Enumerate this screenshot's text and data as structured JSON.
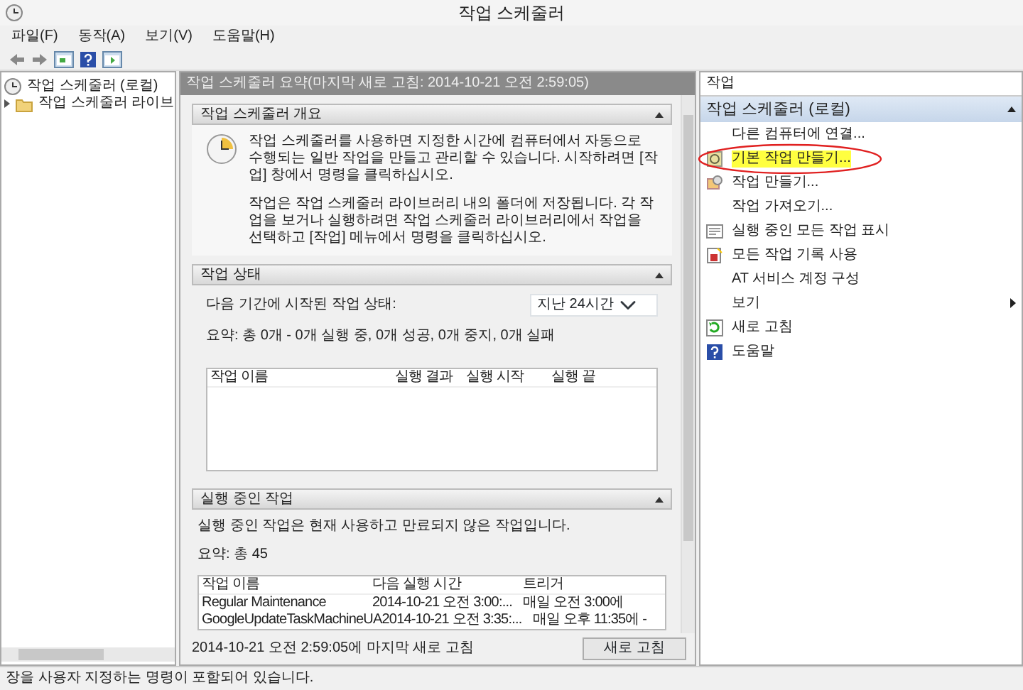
{
  "window": {
    "title": "작업 스케줄러"
  },
  "menu": [
    "파일(F)",
    "동작(A)",
    "보기(V)",
    "도움말(H)"
  ],
  "tree": [
    {
      "label": "작업 스케줄러 (로컬)",
      "children": [
        {
          "label": "작업 스케줄러 라이브",
          "expanded": false
        }
      ]
    }
  ],
  "summary": {
    "title": "작업 스케줄러 요약(마지막 새로 고침: 2014-10-21 오전 2:59:05)",
    "sections": [
      {
        "kind": "overview",
        "title": "작업 스케줄러 개요",
        "paragraphs": [
          "작업 스케줄러를 사용하면 지정한 시간에 컴퓨터에서 자동으로 수행되는 일반 작업을 만들고 관리할 수 있습니다. 시작하려면 [작업] 창에서 명령을 클릭하십시오.",
          "작업은 작업 스케줄러 라이브러리 내의 폴더에 저장됩니다. 각 작업을 보거나 실행하려면 작업 스케줄러 라이브러리에서 작업을 선택하고 [작업] 메뉴에서 명령을 클릭하십시오."
        ]
      },
      {
        "kind": "status",
        "title": "작업 상태",
        "period_label": "다음 기간에 시작된 작업 상태:",
        "period": "지난 24시간",
        "summary": "요약: 총 0개 - 0개 실행 중, 0개 성공, 0개 중지, 0개 실패",
        "table": {
          "columns": [
            "작업 이름",
            "실행 결과",
            "실행 시작",
            "실행 끝"
          ]
        }
      },
      {
        "kind": "running",
        "title": "실행 중인 작업",
        "description": "실행 중인 작업은 현재 사용하고 만료되지 않은 작업입니다.",
        "summary": "요약: 총 45",
        "table": {
          "columns": [
            "작업 이름",
            "다음 실행 시간",
            "트리거"
          ],
          "rows": [
            [
              "Regular Maintenance",
              "2014-10-21 오전 3:00:...",
              "매일 오전 3:00에"
            ],
            [
              "GoogleUpdateTaskMachineUA",
              "2014-10-21 오전 3:35:...",
              "매일 오후 11:35에 -"
            ]
          ]
        }
      }
    ],
    "last_refresh": "2014-10-21 오전 2:59:05에 마지막 새로 고침",
    "refresh_button": "새로 고침"
  },
  "actions": {
    "title": "작업",
    "group": "작업 스케줄러 (로컬)",
    "items": [
      {
        "label": "다른 컴퓨터에 연결...",
        "kind": "none",
        "highlighted": false,
        "submenu": false
      },
      {
        "label": "기본 작업 만들기...",
        "kind": "wizard",
        "highlighted": true,
        "submenu": false
      },
      {
        "label": "작업 만들기...",
        "kind": "task",
        "highlighted": false,
        "submenu": false
      },
      {
        "label": "작업 가져오기...",
        "kind": "none",
        "highlighted": false,
        "submenu": false
      },
      {
        "label": "실행 중인 모든 작업 표시",
        "kind": "list",
        "highlighted": false,
        "submenu": false
      },
      {
        "label": "모든 작업 기록 사용",
        "kind": "history",
        "highlighted": false,
        "submenu": false
      },
      {
        "label": "AT 서비스 계정 구성",
        "kind": "none",
        "highlighted": false,
        "submenu": false
      },
      {
        "label": "보기",
        "kind": "none",
        "highlighted": false,
        "submenu": true
      },
      {
        "label": "새로 고침",
        "kind": "refresh",
        "highlighted": false,
        "submenu": false
      },
      {
        "label": "도움말",
        "kind": "help",
        "highlighted": false,
        "submenu": false
      }
    ]
  },
  "status_bar": "장을 사용자 지정하는 명령이 포함되어 있습니다."
}
